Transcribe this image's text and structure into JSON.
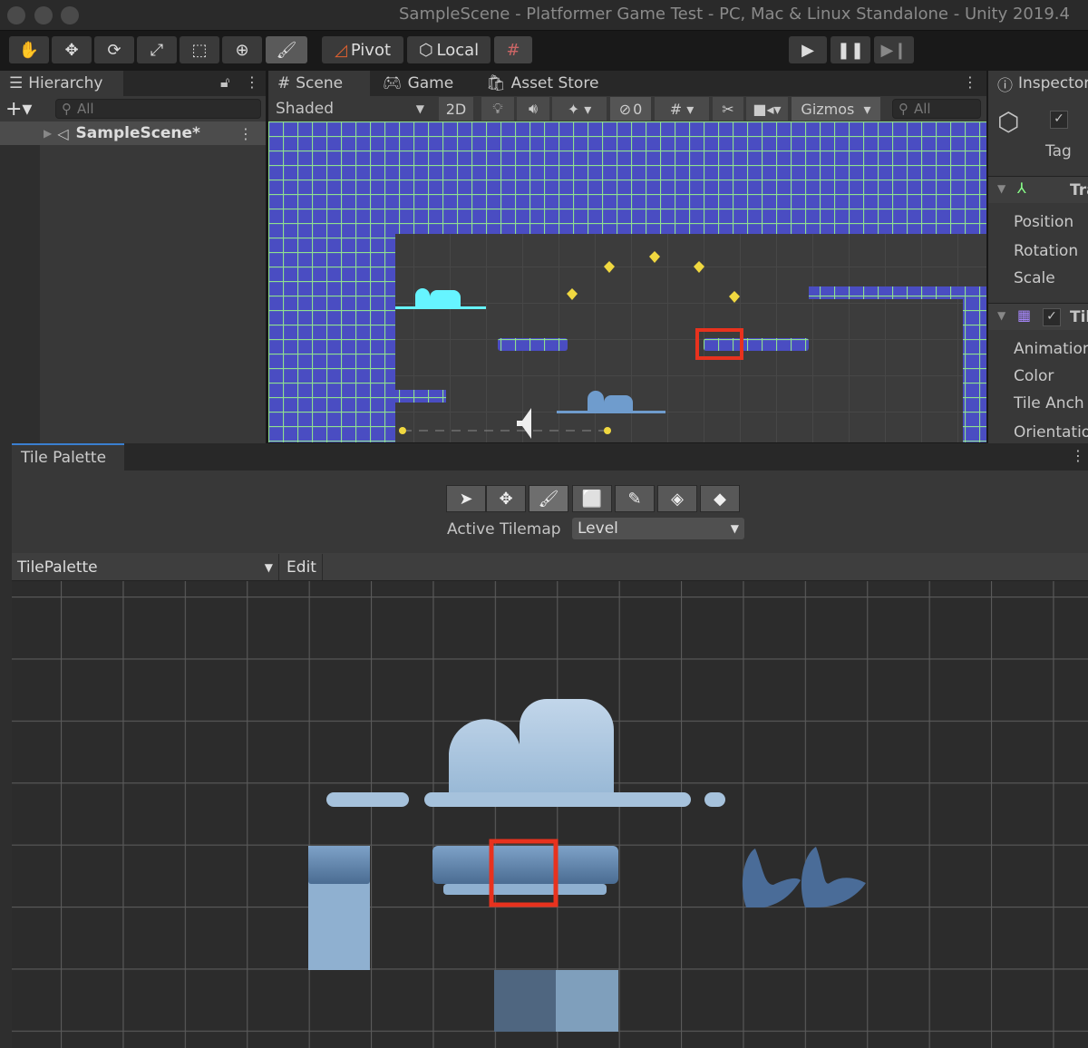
{
  "window": {
    "title": "SampleScene - Platformer Game Test - PC, Mac & Linux Standalone - Unity 2019.4"
  },
  "toolbar": {
    "tools": [
      "hand-icon",
      "move-icon",
      "rotate-icon",
      "scale-icon",
      "rect-icon",
      "transform-icon",
      "brush-icon"
    ],
    "active_tool": "brush-icon",
    "pivot": "Pivot",
    "local": "Local"
  },
  "hierarchy": {
    "tab": "Hierarchy",
    "search_placeholder": "All",
    "items": [
      {
        "label": "SampleScene*"
      }
    ]
  },
  "scene": {
    "tabs": [
      "Scene",
      "Game",
      "Asset Store"
    ],
    "shading": "Shaded",
    "mode_2d": "2D",
    "hidden_count": "0",
    "gizmos": "Gizmos",
    "search_placeholder": "All"
  },
  "inspector": {
    "tab": "Inspector",
    "tag_label": "Tag",
    "transform_header": "Tra",
    "transform_fields": [
      "Position",
      "Rotation",
      "Scale"
    ],
    "tilemap_header": "Til",
    "tilemap_fields": [
      "Animation",
      "Color",
      "Tile Anch",
      "Orientatio"
    ]
  },
  "tile_palette": {
    "tab": "Tile Palette",
    "tools": [
      "select-icon",
      "move-icon",
      "paint-brush-icon",
      "box-fill-icon",
      "picker-icon",
      "eraser-icon",
      "fill-icon"
    ],
    "active_tool": "paint-brush-icon",
    "active_tilemap_label": "Active Tilemap",
    "active_tilemap": "Level",
    "palette": "TilePalette",
    "edit": "Edit"
  },
  "colors": {
    "selection": "#e8321e",
    "tile_blue": "#4a4dc2",
    "grid_green": "#8fe08f"
  }
}
